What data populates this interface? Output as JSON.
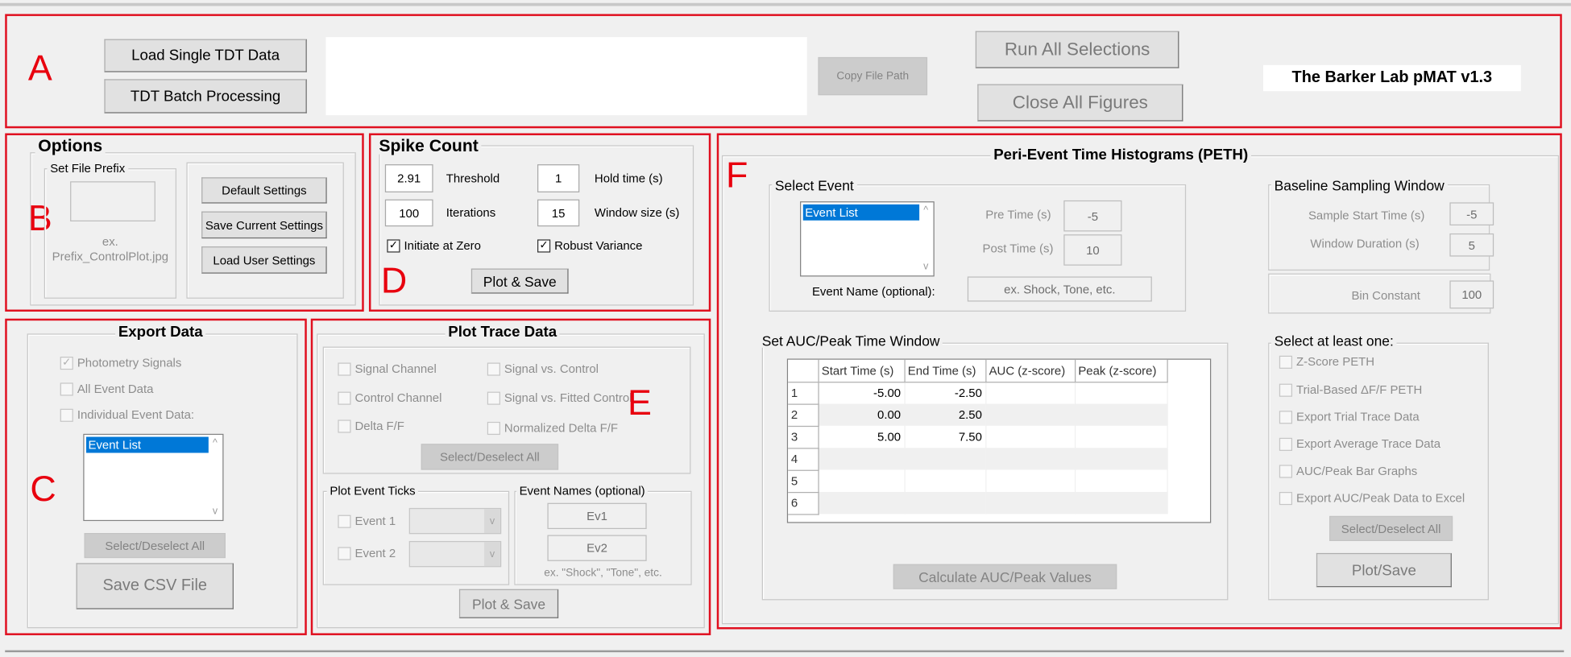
{
  "section_labels": {
    "a": "A",
    "b": "B",
    "c": "C",
    "d": "D",
    "e": "E",
    "f": "F"
  },
  "header": {
    "load_single": "Load Single TDT Data",
    "batch": "TDT Batch Processing",
    "file_path_value": "",
    "copy_path": "Copy File Path",
    "run_all": "Run All Selections",
    "close_all": "Close All Figures",
    "app_title": "The Barker Lab pMAT v1.3"
  },
  "options": {
    "title": "Options",
    "prefix_group": "Set File Prefix",
    "prefix_value": "",
    "prefix_hint_1": "ex.",
    "prefix_hint_2": "Prefix_ControlPlot.jpg",
    "default_settings": "Default Settings",
    "save_settings": "Save Current Settings",
    "load_settings": "Load User Settings"
  },
  "spike": {
    "title": "Spike Count",
    "threshold_value": "2.91",
    "threshold_label": "Threshold",
    "hold_value": "1",
    "hold_label": "Hold time (s)",
    "iterations_value": "100",
    "iterations_label": "Iterations",
    "window_value": "15",
    "window_label": "Window size (s)",
    "initiate_zero": "Initiate at Zero",
    "initiate_zero_checked": true,
    "robust_variance": "Robust Variance",
    "robust_variance_checked": true,
    "plot_save": "Plot & Save"
  },
  "export": {
    "title": "Export Data",
    "photometry": "Photometry Signals",
    "photometry_checked": true,
    "all_event": "All Event Data",
    "individual_event": "Individual Event Data:",
    "event_list": [
      "Event List"
    ],
    "select_all": "Select/Deselect All",
    "save_csv": "Save CSV File"
  },
  "trace": {
    "title": "Plot Trace Data",
    "signal_channel": "Signal Channel",
    "control_channel": "Control Channel",
    "delta_ff": "Delta F/F",
    "signal_vs_control": "Signal vs. Control",
    "signal_vs_fitted": "Signal vs. Fitted Control",
    "normalized_delta": "Normalized Delta F/F",
    "select_all": "Select/Deselect All",
    "ticks_group": "Plot Event Ticks",
    "event1": "Event 1",
    "event2": "Event 2",
    "names_group": "Event Names (optional)",
    "ev1": "Ev1",
    "ev2": "Ev2",
    "names_hint": "ex. \"Shock\", \"Tone\", etc.",
    "plot_save": "Plot & Save"
  },
  "peth": {
    "title": "Peri-Event Time Histograms (PETH)",
    "select_event_group": "Select Event",
    "event_list": [
      "Event List"
    ],
    "pre_time_label": "Pre Time (s)",
    "pre_time_value": "-5",
    "post_time_label": "Post Time (s)",
    "post_time_value": "10",
    "event_name_label": "Event Name (optional):",
    "event_name_placeholder": "ex. Shock, Tone, etc.",
    "baseline_group": "Baseline Sampling Window",
    "sample_start_label": "Sample Start Time (s)",
    "sample_start_value": "-5",
    "window_duration_label": "Window Duration (s)",
    "window_duration_value": "5",
    "bin_constant_label": "Bin Constant",
    "bin_constant_value": "100",
    "auc_group": "Set AUC/Peak Time Window",
    "table": {
      "columns": [
        "Start Time (s)",
        "End Time (s)",
        "AUC (z-score)",
        "Peak (z-score)"
      ],
      "rows": [
        {
          "n": "1",
          "start": "-5.00",
          "end": "-2.50",
          "auc": "",
          "peak": ""
        },
        {
          "n": "2",
          "start": "0.00",
          "end": "2.50",
          "auc": "",
          "peak": ""
        },
        {
          "n": "3",
          "start": "5.00",
          "end": "7.50",
          "auc": "",
          "peak": ""
        },
        {
          "n": "4",
          "start": "",
          "end": "",
          "auc": "",
          "peak": ""
        },
        {
          "n": "5",
          "start": "",
          "end": "",
          "auc": "",
          "peak": ""
        },
        {
          "n": "6",
          "start": "",
          "end": "",
          "auc": "",
          "peak": ""
        }
      ]
    },
    "calculate": "Calculate AUC/Peak Values",
    "select_group": "Select at least one:",
    "outputs": [
      "Z-Score PETH",
      "Trial-Based ΔF/F PETH",
      "Export Trial Trace Data",
      "Export Average Trace Data",
      "AUC/Peak Bar Graphs",
      "Export AUC/Peak Data to Excel"
    ],
    "select_all": "Select/Deselect All",
    "plot_save": "Plot/Save"
  },
  "colors": {
    "annotation_red": "#e01020",
    "selection_blue": "#0078d7",
    "window_bg": "#f0f0f0"
  }
}
